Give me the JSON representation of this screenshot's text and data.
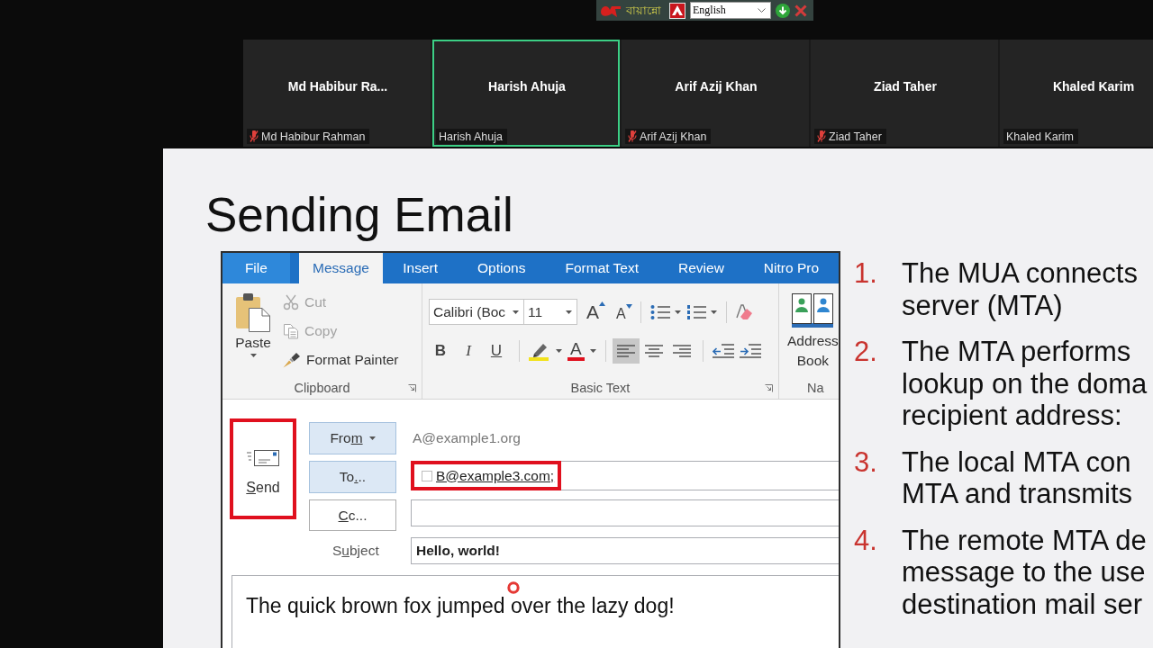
{
  "ime_bar": {
    "name": "বায়ান্নো",
    "language": "English"
  },
  "participants": [
    {
      "name": "Md Habibur Ra...",
      "label": "Md Habibur Rahman",
      "muted": true,
      "speaking": false
    },
    {
      "name": "Harish Ahuja",
      "label": "Harish Ahuja",
      "muted": false,
      "speaking": true
    },
    {
      "name": "Arif Azij Khan",
      "label": "Arif Azij Khan",
      "muted": true,
      "speaking": false
    },
    {
      "name": "Ziad Taher",
      "label": "Ziad Taher",
      "muted": true,
      "speaking": false
    },
    {
      "name": "Khaled Karim",
      "label": "Khaled Karim",
      "muted": false,
      "speaking": false
    }
  ],
  "slide": {
    "title": "Sending Email",
    "outlook": {
      "tabs": [
        {
          "label": "File",
          "kind": "file",
          "selected": false
        },
        {
          "label": "Message",
          "kind": "tab",
          "selected": true
        },
        {
          "label": "Insert",
          "kind": "tab",
          "selected": false
        },
        {
          "label": "Options",
          "kind": "tab",
          "selected": false
        },
        {
          "label": "Format Text",
          "kind": "tab",
          "selected": false
        },
        {
          "label": "Review",
          "kind": "tab",
          "selected": false
        },
        {
          "label": "Nitro Pro",
          "kind": "tab",
          "selected": false
        }
      ],
      "ribbon": {
        "clipboard": {
          "title": "Clipboard",
          "paste": "Paste",
          "items": [
            {
              "kind": "cut",
              "label": "Cut",
              "disabled": true
            },
            {
              "kind": "copy",
              "label": "Copy",
              "disabled": true
            },
            {
              "kind": "painter",
              "label": "Format Painter",
              "disabled": false
            }
          ]
        },
        "basic_text": {
          "title": "Basic Text",
          "font": "Calibri (Boc",
          "size": "11",
          "size_buttons": [
            {
              "kind": "grow",
              "glyph": "A"
            },
            {
              "kind": "shrink",
              "glyph": "A"
            }
          ],
          "styles": [
            {
              "kind": "bold",
              "glyph": "B"
            },
            {
              "kind": "italic",
              "glyph": "I"
            },
            {
              "kind": "underline",
              "glyph": "U"
            }
          ],
          "font_color": "A",
          "alignment": [
            {
              "kind": "left",
              "selected": true
            },
            {
              "kind": "center",
              "selected": false
            },
            {
              "kind": "right",
              "selected": false
            }
          ]
        },
        "names": {
          "title": "Na",
          "address_book": [
            "Address",
            "Book"
          ]
        }
      },
      "send": {
        "label": {
          "key": "S",
          "post": "end"
        },
        "highlighted": true
      },
      "fields": [
        {
          "kind": "from",
          "button": {
            "pre": "Fro",
            "key": "m"
          },
          "active": true,
          "value": "A@example1.org"
        },
        {
          "kind": "to",
          "button": {
            "pre": "To",
            "key": ".",
            "post": ".."
          },
          "active": true,
          "recipient": "B@example3.com;",
          "highlighted": true
        },
        {
          "kind": "cc",
          "button": {
            "key": "C",
            "post": "c..."
          },
          "active": false
        },
        {
          "kind": "subject",
          "label": {
            "pre": "S",
            "key": "u",
            "post": "bject"
          },
          "value": "Hello, world!"
        }
      ],
      "body": "The quick brown fox jumped over the lazy dog!"
    },
    "steps": [
      {
        "number": "1.",
        "lines": [
          "The MUA connects",
          "server (MTA)"
        ]
      },
      {
        "number": "2.",
        "lines": [
          "The MTA performs",
          "lookup on the doma",
          "recipient address:"
        ]
      },
      {
        "number": "3.",
        "lines": [
          "The local MTA con",
          "MTA and transmits"
        ]
      },
      {
        "number": "4.",
        "lines": [
          "The remote MTA de",
          "message to the use",
          "destination mail ser"
        ]
      }
    ]
  }
}
